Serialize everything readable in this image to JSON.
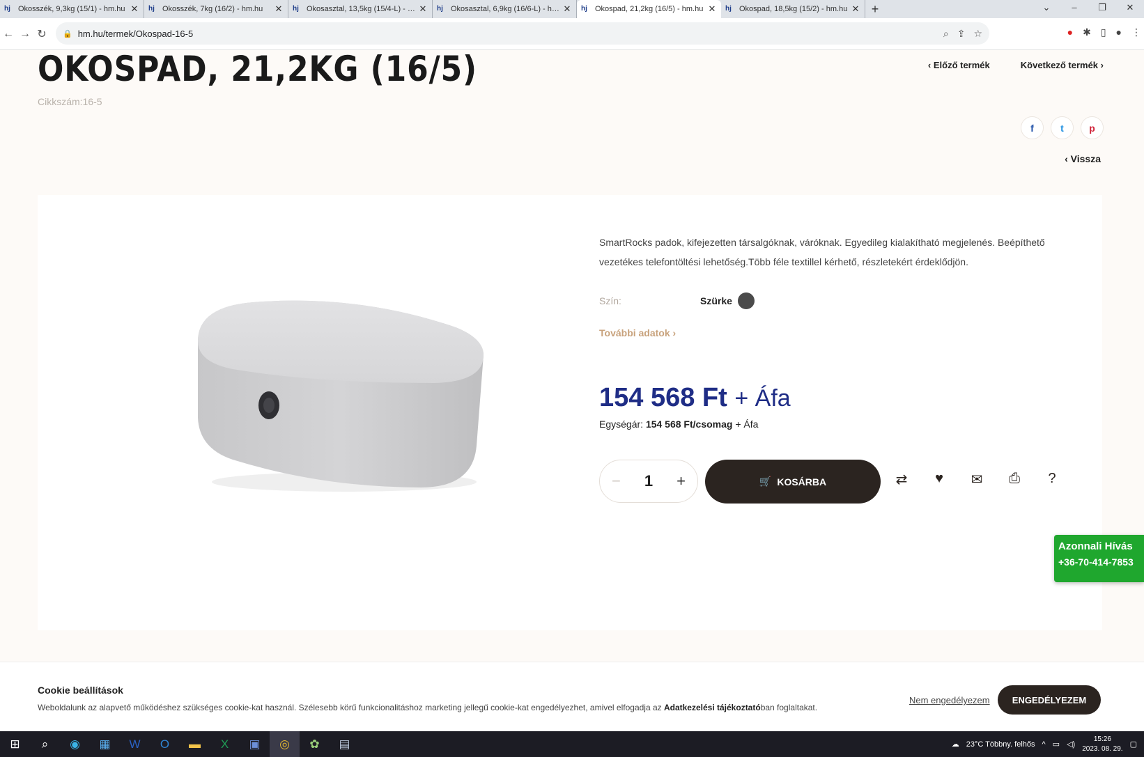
{
  "browser": {
    "tabs": [
      {
        "title": "Okosszék, 9,3kg (15/1) - hm.hu",
        "active": false
      },
      {
        "title": "Okosszék, 7kg (16/2) - hm.hu",
        "active": false
      },
      {
        "title": "Okosasztal, 13,5kg (15/4-L) - hm.",
        "active": false
      },
      {
        "title": "Okosasztal, 6,9kg (16/6-L) - hm.h",
        "active": false
      },
      {
        "title": "Okospad, 21,2kg (16/5) - hm.hu",
        "active": true
      },
      {
        "title": "Okospad, 18,5kg (15/2) - hm.hu",
        "active": false
      }
    ],
    "url": "hm.hu/termek/Okospad-16-5"
  },
  "product": {
    "title": "OKOSPAD, 21,2KG (16/5)",
    "sku": "Cikkszám:16-5",
    "prev": "Előző termék",
    "next": "Következő termék",
    "back": "Vissza",
    "description": "SmartRocks padok, kifejezetten társalgóknak, váróknak. Egyedileg kialakítható megjelenés. Beépíthető vezetékes telefontöltési lehetőség.Több féle textillel kérhető, részletekért érdeklődjön.",
    "color_label": "Szín:",
    "color_value": "Szürke",
    "swatch_color": "#4b4b4b",
    "more_data": "További adatok",
    "price": "154 568 Ft",
    "price_vat": "+ Áfa",
    "unit_label": "Egységár:",
    "unit_price": "154 568 Ft/csomag",
    "unit_vat": "+ Áfa",
    "quantity": "1",
    "cart_label": "KOSÁRBA"
  },
  "call": {
    "title": "Azonnali Hívás",
    "phone": "+36-70-414-7853"
  },
  "cookie": {
    "title": "Cookie beállítások",
    "text_before": "Weboldalunk az alapvető működéshez szükséges cookie-kat használ. Szélesebb körű funkcionalitáshoz marketing jellegű cookie-kat engedélyezhet, amivel elfogadja az ",
    "link": "Adatkezelési tájékoztató",
    "text_after": "ban foglaltakat.",
    "decline": "Nem engedélyezem",
    "accept": "ENGEDÉLYEZEM"
  },
  "taskbar": {
    "weather": "23°C  Többny. felhős",
    "time": "15:26",
    "date": "2023. 08. 29."
  }
}
